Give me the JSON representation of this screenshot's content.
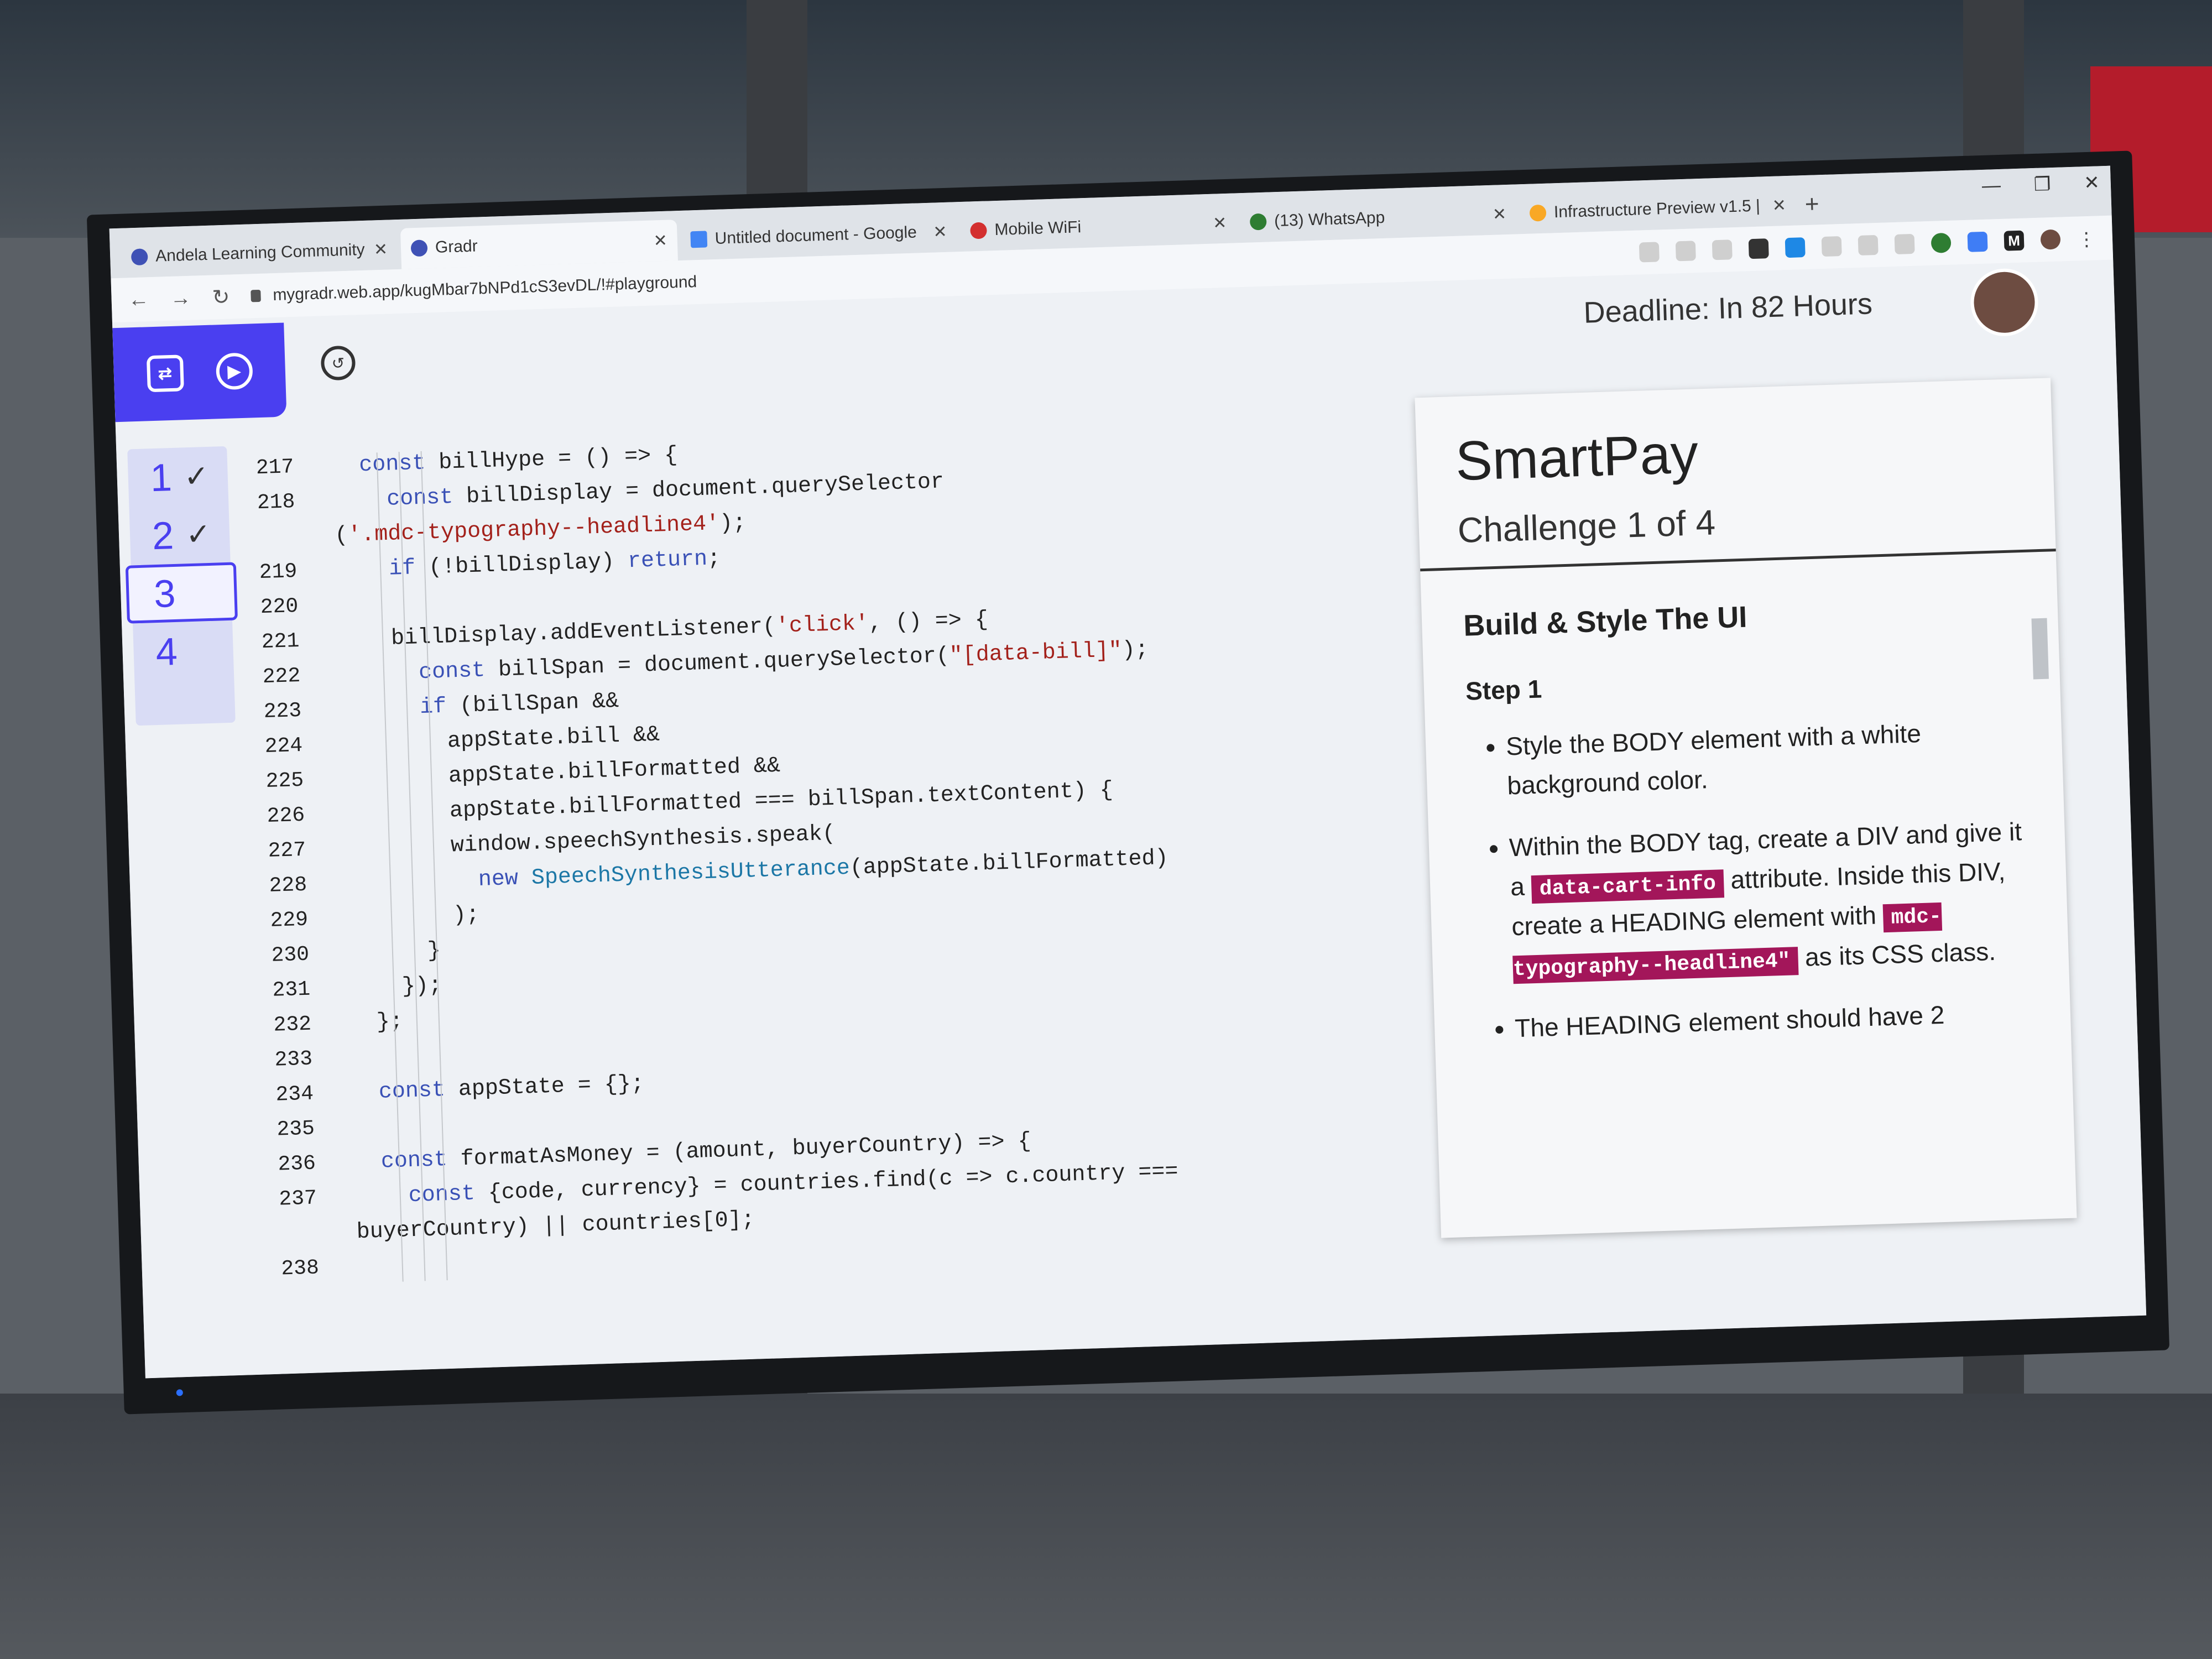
{
  "browser": {
    "tabs": [
      {
        "title": "Andela Learning Community",
        "favicon_color": "#3f51b5"
      },
      {
        "title": "Gradr",
        "favicon_color": "#3f51b5"
      },
      {
        "title": "Untitled document - Google",
        "favicon_color": "#4285f4"
      },
      {
        "title": "Mobile WiFi",
        "favicon_color": "#d32f2f"
      },
      {
        "title": "(13) WhatsApp",
        "favicon_color": "#2e7d32"
      },
      {
        "title": "Infrastructure Preview v1.5 |",
        "favicon_color": "#f9a825"
      }
    ],
    "active_tab_index": 1,
    "new_tab": "+",
    "url": "mygradr.web.app/kugMbar7bNPd1cS3evDL/!#playground"
  },
  "app": {
    "deadline": "Deadline: In 82 Hours",
    "toolbar_accent": "#4a3ff0",
    "steps": [
      {
        "label": "1",
        "done": true
      },
      {
        "label": "2",
        "done": true
      },
      {
        "label": "3",
        "done": false,
        "current": true
      },
      {
        "label": "4",
        "done": false
      }
    ],
    "check_glyph": "✓"
  },
  "editor": {
    "lines": [
      {
        "n": "217",
        "code": "  const billHype = () => {"
      },
      {
        "n": "218",
        "code": "    const billDisplay = document.querySelector"
      },
      {
        "n": "",
        "code": "('.mdc-typography--headline4');"
      },
      {
        "n": "219",
        "code": "    if (!billDisplay) return;"
      },
      {
        "n": "220",
        "code": ""
      },
      {
        "n": "221",
        "code": "    billDisplay.addEventListener('click', () => {"
      },
      {
        "n": "222",
        "code": "      const billSpan = document.querySelector(\"[data-bill]\");"
      },
      {
        "n": "223",
        "code": "      if (billSpan &&"
      },
      {
        "n": "224",
        "code": "        appState.bill &&"
      },
      {
        "n": "225",
        "code": "        appState.billFormatted &&"
      },
      {
        "n": "226",
        "code": "        appState.billFormatted === billSpan.textContent) {"
      },
      {
        "n": "227",
        "code": "        window.speechSynthesis.speak("
      },
      {
        "n": "228",
        "code": "          new SpeechSynthesisUtterance(appState.billFormatted)"
      },
      {
        "n": "229",
        "code": "        );"
      },
      {
        "n": "230",
        "code": "      }"
      },
      {
        "n": "231",
        "code": "    });"
      },
      {
        "n": "232",
        "code": "  };"
      },
      {
        "n": "233",
        "code": ""
      },
      {
        "n": "234",
        "code": "  const appState = {};"
      },
      {
        "n": "235",
        "code": ""
      },
      {
        "n": "236",
        "code": "  const formatAsMoney = (amount, buyerCountry) => {"
      },
      {
        "n": "237",
        "code": "    const {code, currency} = countries.find(c => c.country ==="
      },
      {
        "n": "",
        "code": "buyerCountry) || countries[0];"
      },
      {
        "n": "238",
        "code": ""
      }
    ]
  },
  "challenge": {
    "title": "SmartPay",
    "subtitle": "Challenge 1 of 4",
    "section": "Build & Style The UI",
    "step": "Step 1",
    "bullet1": "Style the BODY element with a white background color.",
    "bullet2_a": "Within the BODY tag, create a DIV and give it a",
    "bullet2_code1": "data-cart-info",
    "bullet2_b": "attribute. Inside this DIV, create a HEADING element with",
    "bullet2_code2": "mdc-typography--headline4\"",
    "bullet2_c": "as its CSS class.",
    "bullet3": "The HEADING element should have 2",
    "highlight_color": "#a3165a"
  }
}
